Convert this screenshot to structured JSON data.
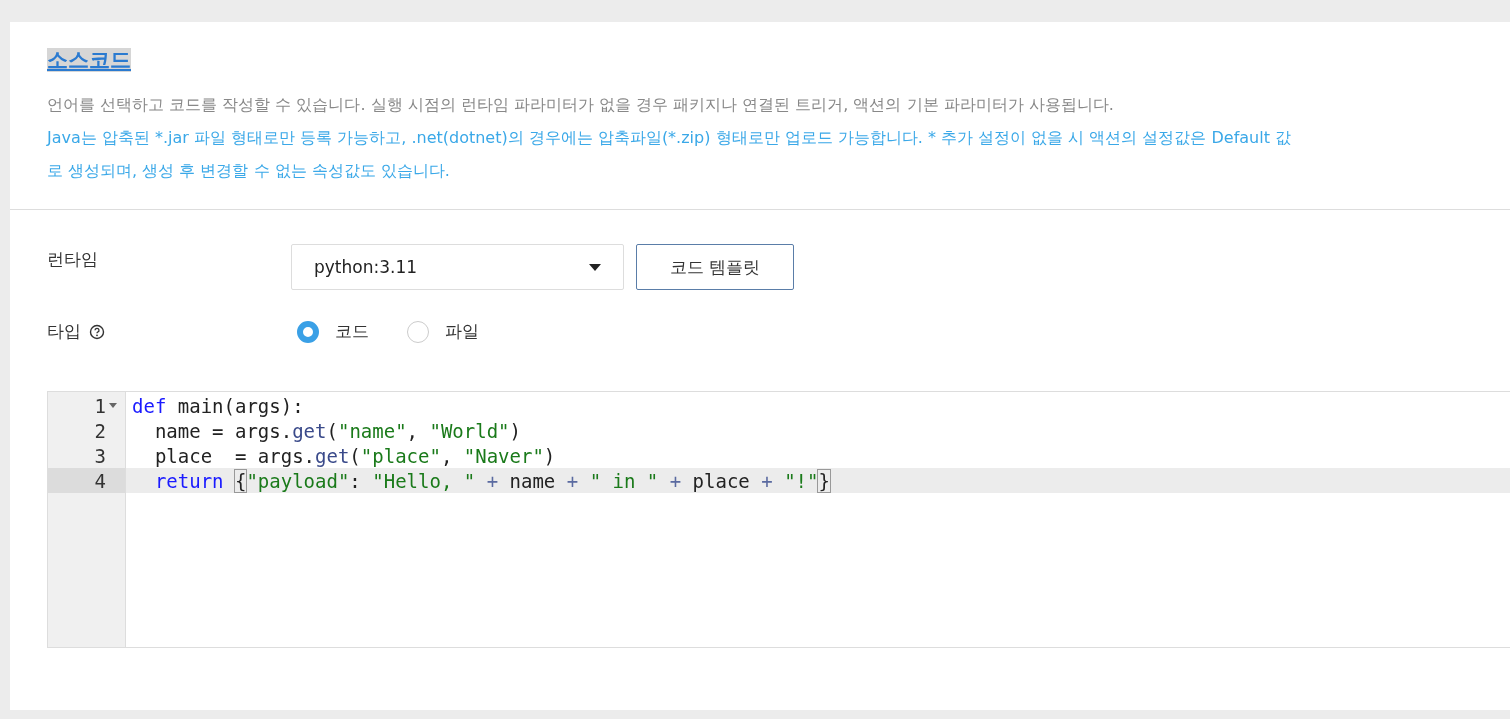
{
  "header": {
    "title": "소스코드",
    "description": "언어를 선택하고 코드를 작성할 수 있습니다. 실행 시점의 런타임 파라미터가 없을 경우 패키지나 연결된 트리거, 액션의 기본 파라미터가 사용됩니다.",
    "notes": [
      "Java는 압축된 *.jar 파일 형태로만 등록 가능하고, .net(dotnet)의 경우에는 압축파일(*.zip) 형태로만 업로드 가능합니다. * 추가 설정이 없을 시 액션의 설정값은 Default 값",
      "로 생성되며, 생성 후 변경할 수 없는 속성값도 있습니다."
    ]
  },
  "runtime": {
    "label": "런타임",
    "value": "python:3.11",
    "template_button": "코드 템플릿"
  },
  "type": {
    "label": "타입",
    "options": [
      {
        "label": "코드",
        "selected": true
      },
      {
        "label": "파일",
        "selected": false
      }
    ]
  },
  "editor": {
    "lines": [
      {
        "number": "1",
        "active": false,
        "foldable": true,
        "tokens": [
          {
            "kind": "keyword",
            "text": "def"
          },
          {
            "kind": "plain",
            "text": " main(args):"
          }
        ]
      },
      {
        "number": "2",
        "active": false,
        "foldable": false,
        "tokens": [
          {
            "kind": "plain",
            "text": "  name = args."
          },
          {
            "kind": "method",
            "text": "get"
          },
          {
            "kind": "plain",
            "text": "("
          },
          {
            "kind": "string",
            "text": "\"name\""
          },
          {
            "kind": "plain",
            "text": ", "
          },
          {
            "kind": "string",
            "text": "\"World\""
          },
          {
            "kind": "plain",
            "text": ")"
          }
        ]
      },
      {
        "number": "3",
        "active": false,
        "foldable": false,
        "tokens": [
          {
            "kind": "plain",
            "text": "  place  = args."
          },
          {
            "kind": "method",
            "text": "get"
          },
          {
            "kind": "plain",
            "text": "("
          },
          {
            "kind": "string",
            "text": "\"place\""
          },
          {
            "kind": "plain",
            "text": ", "
          },
          {
            "kind": "string",
            "text": "\"Naver\""
          },
          {
            "kind": "plain",
            "text": ")"
          }
        ]
      },
      {
        "number": "4",
        "active": true,
        "foldable": false,
        "tokens": [
          {
            "kind": "keyword",
            "text": "  return "
          },
          {
            "kind": "bracket",
            "text": "{"
          },
          {
            "kind": "string",
            "text": "\"payload\""
          },
          {
            "kind": "plain",
            "text": ": "
          },
          {
            "kind": "string",
            "text": "\"Hello, \""
          },
          {
            "kind": "operator",
            "text": " + "
          },
          {
            "kind": "plain",
            "text": "name"
          },
          {
            "kind": "operator",
            "text": " + "
          },
          {
            "kind": "string",
            "text": "\" in \""
          },
          {
            "kind": "operator",
            "text": " + "
          },
          {
            "kind": "plain",
            "text": "place"
          },
          {
            "kind": "operator",
            "text": " + "
          },
          {
            "kind": "string",
            "text": "\"!\""
          },
          {
            "kind": "bracket",
            "text": "}"
          }
        ]
      }
    ]
  }
}
